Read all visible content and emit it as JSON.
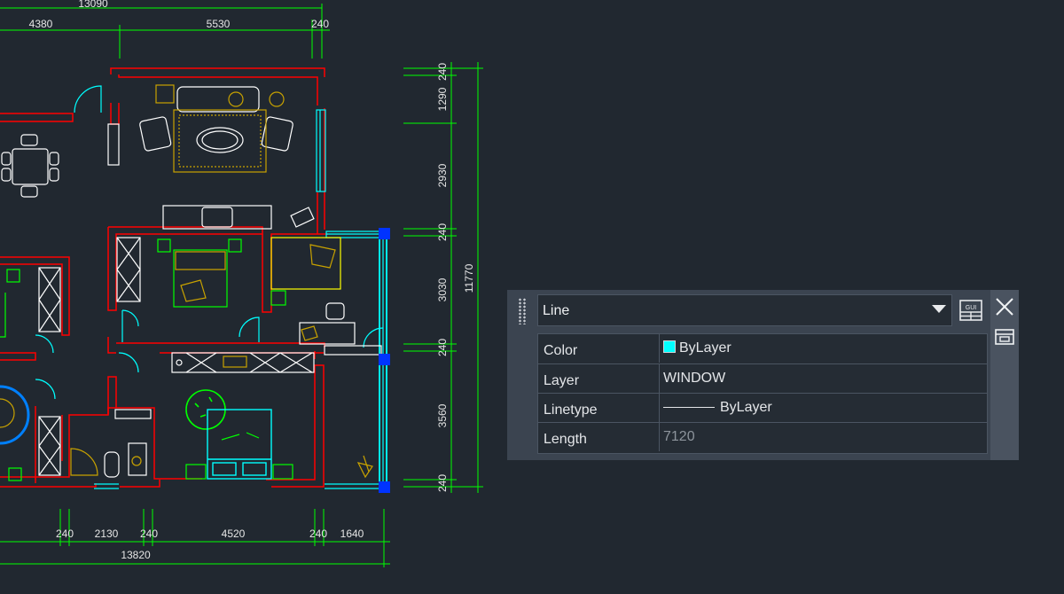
{
  "drawing": {
    "dims": {
      "overall_top": "13090",
      "top": [
        "4380",
        "5530",
        "240"
      ],
      "right": [
        "240",
        "1290",
        "2930",
        "240",
        "3030",
        "240",
        "3560",
        "240"
      ],
      "right_total": "11770",
      "bottom": [
        "240",
        "2130",
        "240",
        "4520",
        "240",
        "1640"
      ],
      "bottom_total": "13820"
    },
    "colors": {
      "background": "#212830",
      "walls": "#ff0000",
      "dimension": "#00ff00",
      "window": "#00ffff",
      "furniture": "#ffff00",
      "grip": "#0033ff"
    }
  },
  "properties_palette": {
    "selection": "Line",
    "quick_select_icon": "quick-select-icon",
    "close_icon": "close-icon",
    "auto_hide_icon": "auto-hide-icon",
    "rows": [
      {
        "name": "Color",
        "value": "ByLayer",
        "swatch": "#00ffff"
      },
      {
        "name": "Layer",
        "value": "WINDOW"
      },
      {
        "name": "Linetype",
        "value": "ByLayer"
      },
      {
        "name": "Length",
        "value": "7120"
      }
    ]
  }
}
